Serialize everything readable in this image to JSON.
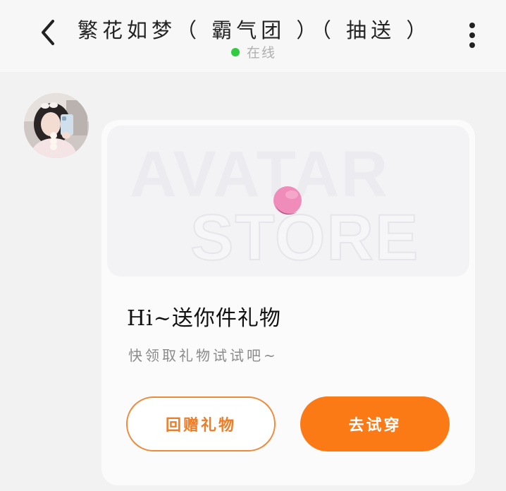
{
  "header": {
    "title": "繁花如梦（ 霸气团 ）（ 抽送 ）",
    "status_text": "在线",
    "status_color": "#2ecc40",
    "back_icon": "chevron-left-icon",
    "more_icon": "vertical-dots-icon"
  },
  "card": {
    "banner_watermark_top": "AVATAR",
    "banner_watermark_bottom": "STORE",
    "title": "Hi~送你件礼物",
    "subtitle": "快领取礼物试试吧~",
    "return_gift_label": "回赠礼物",
    "try_on_label": "去试穿"
  },
  "colors": {
    "accent": "#fb7a15",
    "outline_button": "#ef8a3a"
  }
}
